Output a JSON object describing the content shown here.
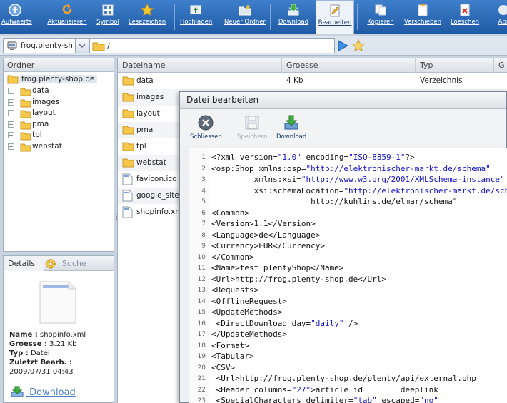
{
  "toolbar": {
    "items": [
      {
        "id": "up",
        "label": "Aufwaerts",
        "icon": "arrow-up-icon"
      },
      {
        "id": "refresh",
        "label": "Aktualisieren",
        "icon": "refresh-icon"
      },
      {
        "id": "symbol",
        "label": "Symbol",
        "icon": "symbol-view-icon"
      },
      {
        "id": "bookmarks",
        "label": "Lesezeichen",
        "icon": "star-icon"
      },
      {
        "id": "upload",
        "label": "Hochladen",
        "icon": "upload-icon"
      },
      {
        "id": "newfolder",
        "label": "Neuer Ordner",
        "icon": "new-folder-icon"
      },
      {
        "id": "download",
        "label": "Download",
        "icon": "download-icon"
      },
      {
        "id": "edit",
        "label": "Bearbeiten",
        "icon": "edit-icon"
      },
      {
        "id": "copy",
        "label": "Kopieren",
        "icon": "copy-icon"
      },
      {
        "id": "move",
        "label": "Verschieben",
        "icon": "move-icon"
      },
      {
        "id": "delete",
        "label": "Loeschen",
        "icon": "delete-icon"
      },
      {
        "id": "cut",
        "label": "Abr",
        "icon": "cancel-icon"
      }
    ]
  },
  "address": {
    "host": "frog.plenty-sh",
    "path": "/"
  },
  "folders": {
    "title": "Ordner",
    "root": "frog.plenty-shop.de",
    "items": [
      "data",
      "images",
      "layout",
      "pma",
      "tpl",
      "webstat"
    ]
  },
  "details": {
    "tab_details": "Details",
    "tab_search": "Suche",
    "lines": [
      {
        "k": "Name :",
        "v": " shopinfo.xml"
      },
      {
        "k": "Groesse :",
        "v": " 3.21 Kb"
      },
      {
        "k": "Typ :",
        "v": " Datei"
      },
      {
        "k": "Zuletzt Bearb. :",
        "v": ""
      },
      {
        "k": "",
        "v": "2009/07/31 04:43"
      }
    ],
    "download": "Download"
  },
  "files": {
    "columns": [
      "Dateiname",
      "Groesse",
      "Typ",
      "G"
    ],
    "rows": [
      {
        "name": "data",
        "size": "4 Kb",
        "type": "Verzeichnis",
        "kind": "folder"
      },
      {
        "name": "images",
        "size": "",
        "type": "",
        "kind": "folder"
      },
      {
        "name": "layout",
        "size": "",
        "type": "",
        "kind": "folder"
      },
      {
        "name": "pma",
        "size": "",
        "type": "",
        "kind": "folder"
      },
      {
        "name": "tpl",
        "size": "",
        "type": "",
        "kind": "folder"
      },
      {
        "name": "webstat",
        "size": "",
        "type": "",
        "kind": "folder"
      },
      {
        "name": "favicon.ico",
        "size": "",
        "type": "",
        "kind": "file"
      },
      {
        "name": "google_sitem",
        "size": "",
        "type": "",
        "kind": "file"
      },
      {
        "name": "shopinfo.xml",
        "size": "",
        "type": "",
        "kind": "file"
      }
    ]
  },
  "dialog": {
    "title": "Datei bearbeiten",
    "close": "Schliessen",
    "save": "Speichern",
    "download": "Download"
  },
  "editor": {
    "lines": [
      [
        [
          "t",
          "<?xml version="
        ],
        [
          "s",
          "\"1.0\""
        ],
        [
          "t",
          " encoding="
        ],
        [
          "s",
          "\"ISO-8859-1\""
        ],
        [
          "t",
          "?>"
        ]
      ],
      [
        [
          "t",
          "<osp:Shop xmlns:osp="
        ],
        [
          "s",
          "\"http://elektronischer-markt.de/schema\""
        ]
      ],
      [
        [
          "t",
          "         xmlns:xsi="
        ],
        [
          "s",
          "\"http://www.w3.org/2001/XMLSchema-instance\""
        ]
      ],
      [
        [
          "t",
          "         xsi:schemaLocation="
        ],
        [
          "s",
          "\"http://elektronischer-markt.de/schema"
        ]
      ],
      [
        [
          "t",
          "                     http://kuhlins.de/elmar/schema\""
        ]
      ],
      [
        [
          "t",
          "<Common>"
        ]
      ],
      [
        [
          "t",
          "<Version>1.1</Version>"
        ]
      ],
      [
        [
          "t",
          "<Language>de</Language>"
        ]
      ],
      [
        [
          "t",
          "<Currency>EUR</Currency>"
        ]
      ],
      [
        [
          "t",
          "</Common>"
        ]
      ],
      [
        [
          "t",
          "<Name>test|plentyShop</Name>"
        ]
      ],
      [
        [
          "t",
          "<Url>http://frog.plenty-shop.de</Url>"
        ]
      ],
      [
        [
          "t",
          "<Requests>"
        ]
      ],
      [
        [
          "t",
          "<OfflineRequest>"
        ]
      ],
      [
        [
          "t",
          "<UpdateMethods>"
        ]
      ],
      [
        [
          "t",
          " <DirectDownload day="
        ],
        [
          "s",
          "\"daily\""
        ],
        [
          "t",
          " />"
        ]
      ],
      [
        [
          "t",
          "</UpdateMethods>"
        ]
      ],
      [
        [
          "t",
          "<Format>"
        ]
      ],
      [
        [
          "t",
          "<Tabular>"
        ]
      ],
      [
        [
          "t",
          "<CSV>"
        ]
      ],
      [
        [
          "t",
          " <Url>http://frog.plenty-shop.de/plenty/api/external.php"
        ]
      ],
      [
        [
          "t",
          " <Header columns="
        ],
        [
          "s",
          "\"27\""
        ],
        [
          "t",
          ">article_id        deeplink"
        ]
      ],
      [
        [
          "t",
          " <SpecialCharacters delimiter="
        ],
        [
          "s",
          "\"tab\""
        ],
        [
          "t",
          " escaped="
        ],
        [
          "s",
          "\"no\""
        ]
      ]
    ]
  }
}
